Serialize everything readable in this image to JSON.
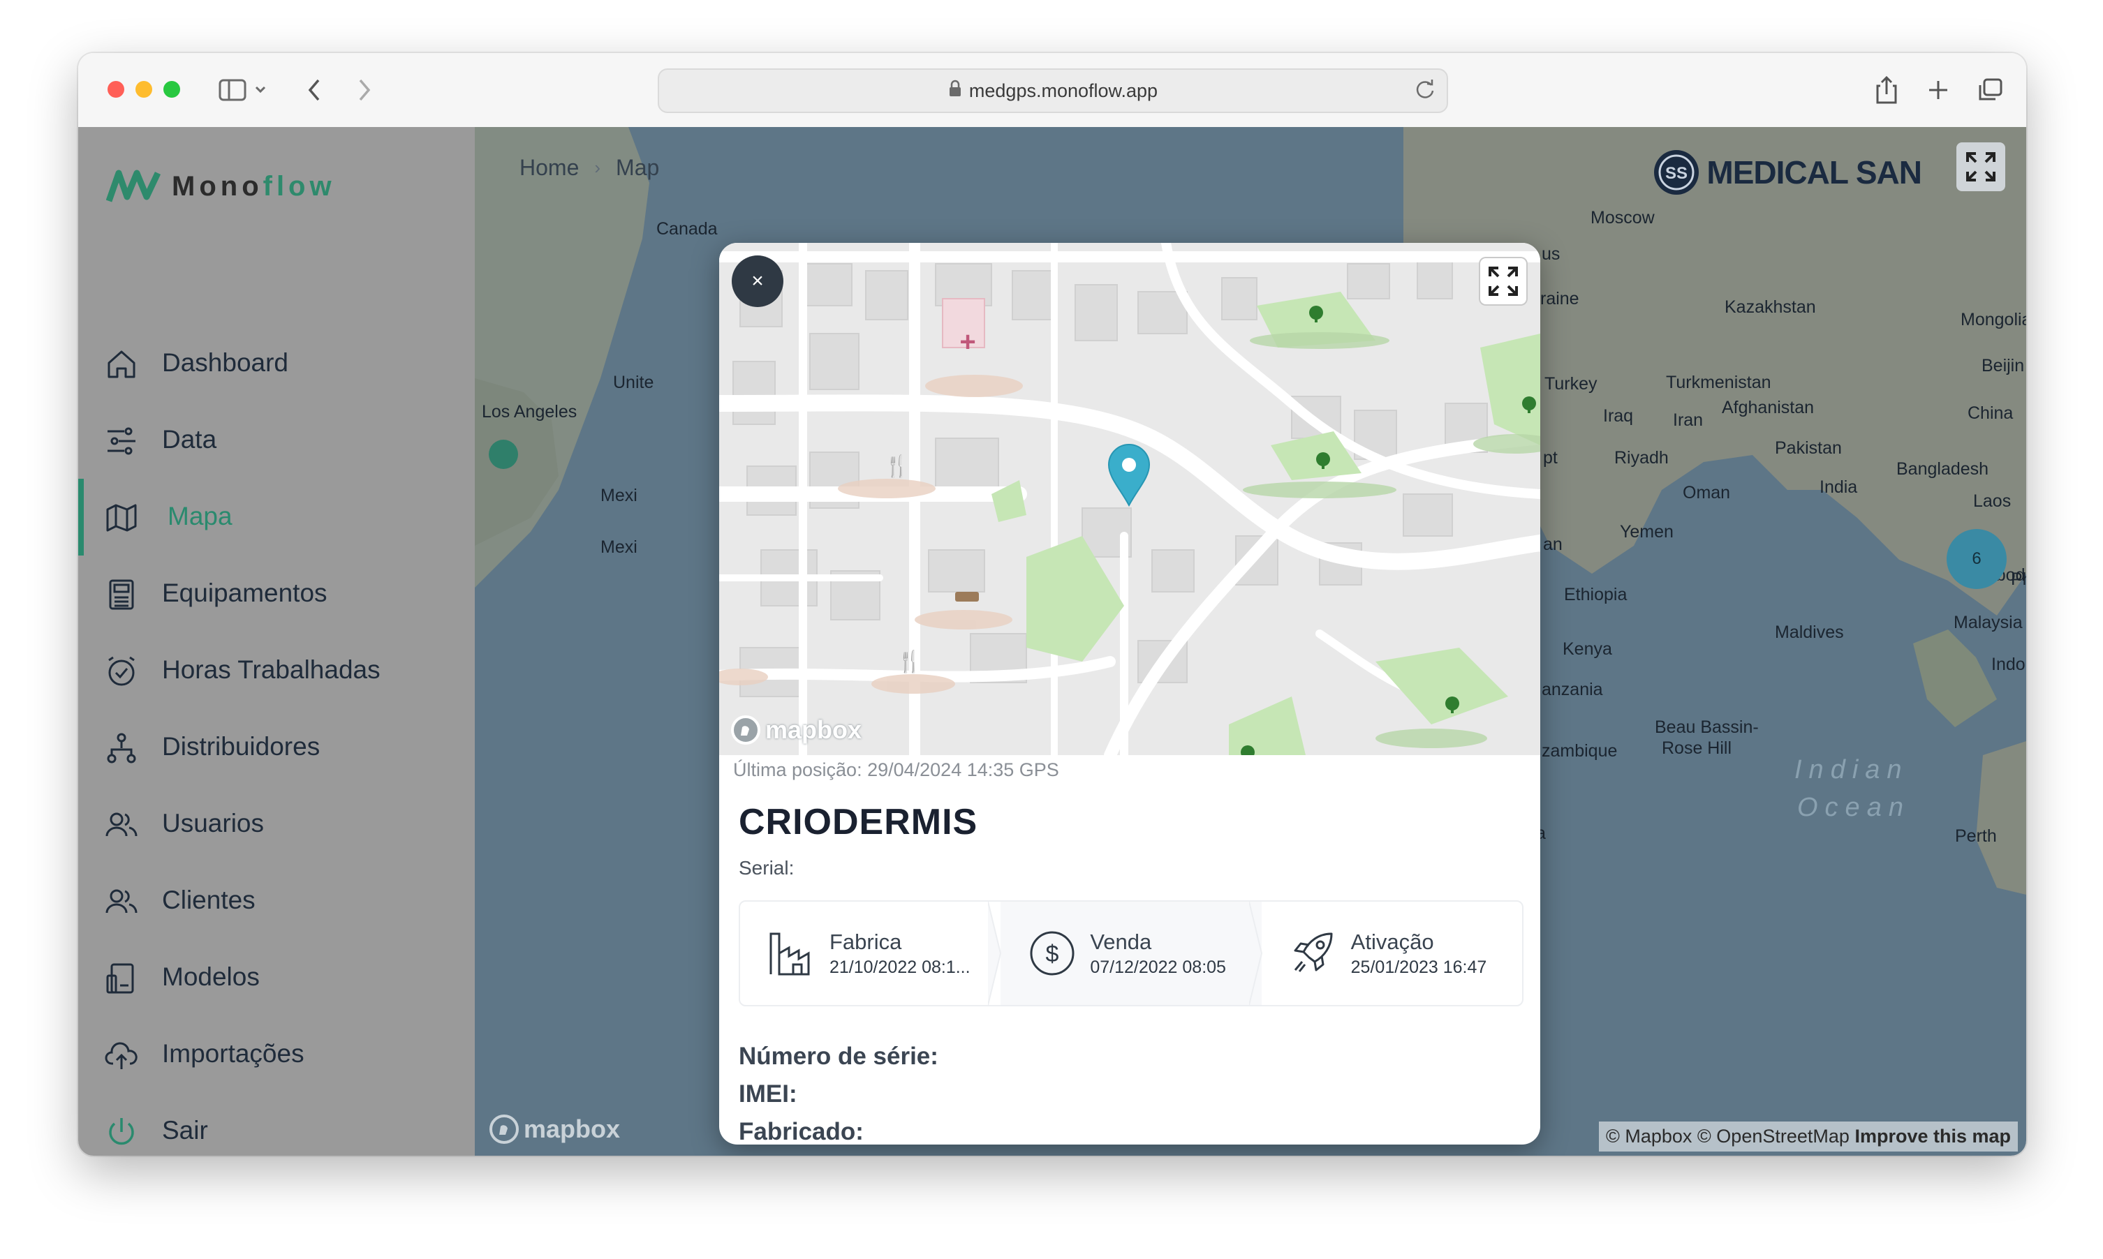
{
  "browser": {
    "url": "medgps.monoflow.app"
  },
  "sidebar": {
    "brand_mono": "Mono",
    "brand_flow": "flow",
    "items": [
      {
        "label": "Dashboard",
        "icon": "home-icon"
      },
      {
        "label": "Data",
        "icon": "sliders-icon"
      },
      {
        "label": "Mapa",
        "icon": "map-icon",
        "active": true
      },
      {
        "label": "Equipamentos",
        "icon": "device-icon"
      },
      {
        "label": "Horas Trabalhadas",
        "icon": "alarm-clock-icon"
      },
      {
        "label": "Distribuidores",
        "icon": "org-chart-icon"
      },
      {
        "label": "Usuarios",
        "icon": "users-icon"
      },
      {
        "label": "Clientes",
        "icon": "users-icon"
      },
      {
        "label": "Modelos",
        "icon": "models-icon"
      },
      {
        "label": "Importações",
        "icon": "cloud-upload-icon"
      },
      {
        "label": "Sair",
        "icon": "power-icon"
      }
    ]
  },
  "breadcrumb": {
    "home": "Home",
    "current": "Map"
  },
  "header": {
    "logo_text": "MEDICAL SAN"
  },
  "map": {
    "labels": {
      "canada": "Canada",
      "united": "Unite",
      "los_angeles": "Los Angeles",
      "mexico1": "Mexi",
      "mexico2": "Mexi",
      "moscow": "Moscow",
      "us": "us",
      "ukraine": "raine",
      "kazakhstan": "Kazakhstan",
      "mongolia": "Mongolia",
      "beijing": "Beijin",
      "turkey": "Turkey",
      "turkmenistan": "Turkmenistan",
      "iraq": "Iraq",
      "iran": "Iran",
      "afghanistan": "Afghanistan",
      "china": "China",
      "pakistan": "Pakistan",
      "egypt": "pt",
      "riyadh": "Riyadh",
      "oman": "Oman",
      "india": "India",
      "bangladesh": "Bangladesh",
      "laos": "Laos",
      "sudan": "an",
      "yemen": "Yemen",
      "ethiopia": "Ethiopia",
      "cambodia": "Cambodia",
      "philippines": "Ph",
      "maldives": "Maldives",
      "malaysia": "Malaysia",
      "kenya": "Kenya",
      "indonesia": "Indone",
      "tanzania": "anzania",
      "mozambique": "zambique",
      "beau_bassin": "Beau Bassin-",
      "rose_hill": "Rose Hill",
      "indian": "Indian",
      "ocean": "Ocean",
      "perth": "Perth",
      "a": "a"
    },
    "cluster_count": "6",
    "mapbox": "mapbox",
    "attribution_1": "© Mapbox © OpenStreetMap",
    "attribution_2": "Improve this map"
  },
  "modal": {
    "close_label": "×",
    "mapbox": "mapbox",
    "last_position": "Última posição: 29/04/2024 14:35 GPS",
    "device_name": "CRIODERMIS",
    "serial_label": "Serial:",
    "timeline": [
      {
        "title": "Fabrica",
        "date": "21/10/2022 08:1...",
        "icon": "factory-icon"
      },
      {
        "title": "Venda",
        "date": "07/12/2022 08:05",
        "icon": "dollar-icon"
      },
      {
        "title": "Ativação",
        "date": "25/01/2023 16:47",
        "icon": "rocket-icon"
      }
    ],
    "details": {
      "serial_number": "Número de série:",
      "imei": "IMEI:",
      "manufactured": "Fabricado:"
    }
  },
  "colors": {
    "accent": "#2a8a6e",
    "sidebar_bg": "#9a9a9a",
    "marker": "#3aaecb"
  }
}
